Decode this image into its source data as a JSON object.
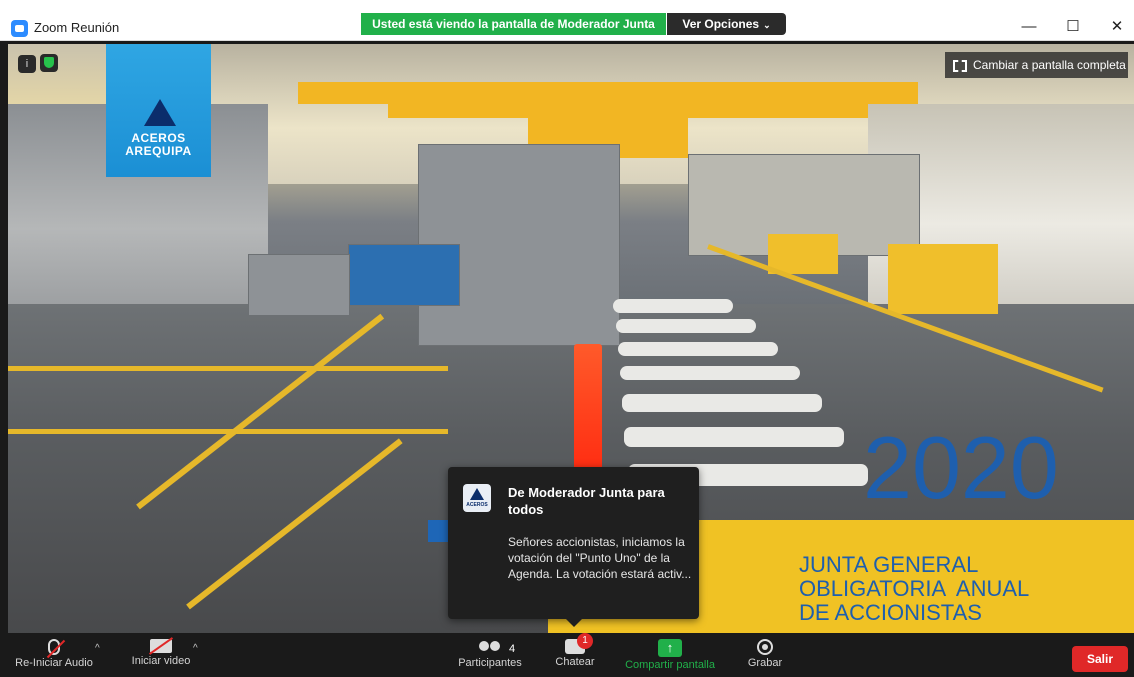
{
  "window": {
    "title": "Zoom Reunión",
    "share_banner": "Usted está viendo la pantalla de Moderador Junta",
    "view_options": "Ver Opciones",
    "minimize": "—",
    "maximize": "☐",
    "close": "✕"
  },
  "stage": {
    "fullscreen_label": "Cambiar a pantalla completa",
    "info_glyph": "i",
    "logo_text_1": "ACEROS",
    "logo_text_2": "AREQUIPA",
    "year": "2020",
    "event_title_1": "JUNTA GENERAL",
    "event_title_2": "OBLIGATORIA  ANUAL",
    "event_title_3": "DE ACCIONISTAS"
  },
  "chat_notification": {
    "avatar_label": "ACEROS",
    "sender": "De Moderador Junta para todos",
    "message": "Señores accionistas, iniciamos la votación del \"Punto Uno\" de la Agenda. La votación estará activ..."
  },
  "toolbar": {
    "audio_label": "Re-Iniciar Audio",
    "video_label": "Iniciar video",
    "participants_label": "Participantes",
    "participants_count": "4",
    "chat_label": "Chatear",
    "chat_badge": "1",
    "share_label": "Compartir pantalla",
    "share_glyph": "↑",
    "record_label": "Grabar",
    "leave_label": "Salir",
    "caret": "^"
  },
  "colors": {
    "share_banner_bg": "#21b04a",
    "leave_bg": "#e02828",
    "brand_blue": "#1e5fae",
    "brand_yellow": "#f0c224"
  },
  "icons": [
    "app-zoom-icon",
    "info-icon",
    "shield-icon",
    "fullscreen-icon",
    "mic-muted-icon",
    "video-off-icon",
    "participants-icon",
    "chat-icon",
    "share-screen-icon",
    "record-icon",
    "chevron-down-icon"
  ]
}
